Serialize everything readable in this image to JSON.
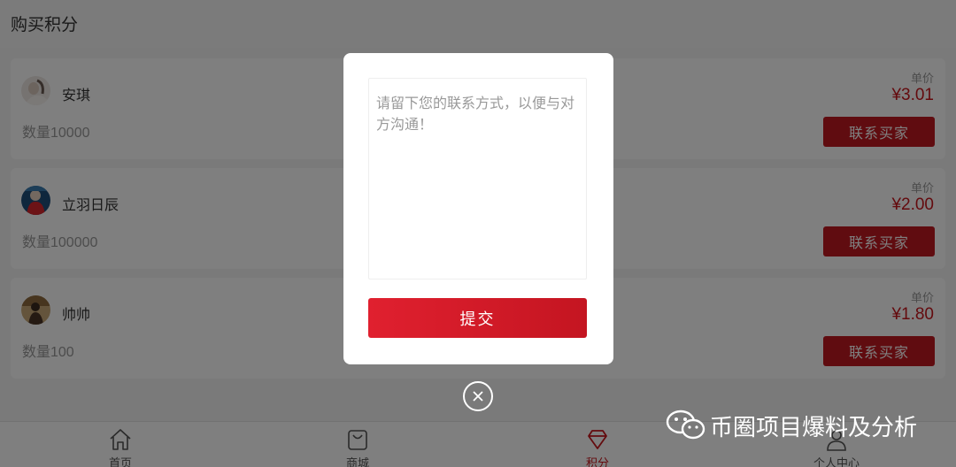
{
  "header": {
    "title": "购买积分"
  },
  "listings": [
    {
      "name": "安琪",
      "quantity": "数量10000",
      "unit_label": "单价",
      "price": "¥3.01",
      "button_label": "联系买家"
    },
    {
      "name": "立羽日辰",
      "quantity": "数量100000",
      "unit_label": "单价",
      "price": "¥2.00",
      "button_label": "联系买家"
    },
    {
      "name": "帅帅",
      "quantity": "数量100",
      "unit_label": "单价",
      "price": "¥1.80",
      "button_label": "联系买家"
    }
  ],
  "tabs": [
    {
      "label": "首页",
      "icon": "home-icon"
    },
    {
      "label": "商城",
      "icon": "shopping-bag-icon"
    },
    {
      "label": "积分",
      "icon": "diamond-icon",
      "active": true
    },
    {
      "label": "个人中心",
      "icon": "user-icon"
    }
  ],
  "modal": {
    "placeholder": "请留下您的联系方式，以便与对方沟通！",
    "submit_label": "提交"
  },
  "watermark": {
    "text": "币圈项目爆料及分析",
    "icon": "wechat-icon"
  },
  "colors": {
    "accent": "#c01820",
    "price": "#c8161d",
    "overlay": "rgba(0,0,0,0.5)"
  }
}
